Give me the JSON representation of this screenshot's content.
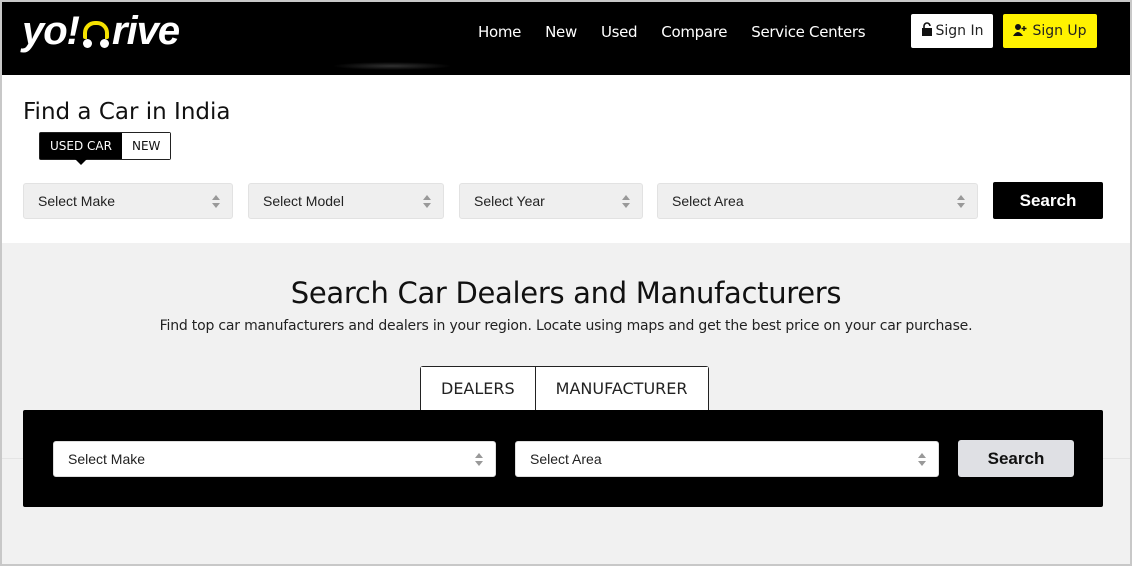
{
  "header": {
    "logo": {
      "part1": "yo!",
      "part2": "rive"
    },
    "nav": [
      "Home",
      "New",
      "Used",
      "Compare",
      "Service Centers"
    ],
    "sign_in": {
      "label": "Sign In",
      "icon": "unlock-icon"
    },
    "sign_up": {
      "label": "Sign Up",
      "icon": "add-user-icon"
    }
  },
  "find_car": {
    "title": "Find a Car in India",
    "toggle": {
      "options": [
        "USED CAR",
        "NEW"
      ],
      "active": "USED CAR"
    },
    "selects": {
      "make": "Select Make",
      "model": "Select Model",
      "year": "Select Year",
      "area": "Select Area"
    },
    "search_label": "Search"
  },
  "dealers": {
    "title": "Search Car Dealers and Manufacturers",
    "subtitle": "Find top car manufacturers and dealers in your region. Locate using maps and get the best price on your car purchase.",
    "tabs": [
      "DEALERS",
      "MANUFACTURER"
    ],
    "selects": {
      "make": "Select Make",
      "area": "Select Area"
    },
    "search_label": "Search"
  },
  "colors": {
    "brand_yellow": "#fff200",
    "header_bg": "#000000",
    "page_bg": "#f1f1f1"
  }
}
